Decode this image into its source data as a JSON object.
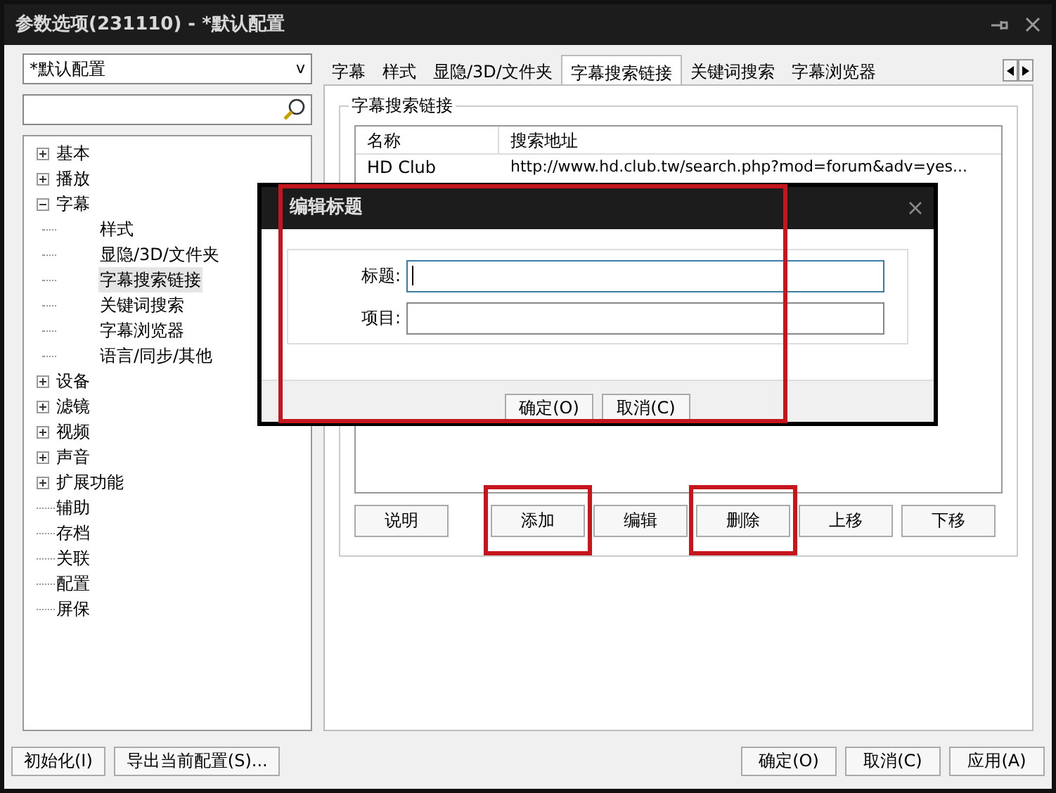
{
  "window": {
    "title": "参数选项(231110) - *默认配置"
  },
  "profile_dropdown": {
    "value": "*默认配置",
    "caret": "v"
  },
  "tree": [
    {
      "label": "基本",
      "expanded": false,
      "selected": false
    },
    {
      "label": "播放",
      "expanded": false,
      "selected": false
    },
    {
      "label": "字幕",
      "expanded": true,
      "selected": false,
      "children": [
        {
          "label": "样式",
          "selected": false
        },
        {
          "label": "显隐/3D/文件夹",
          "selected": false
        },
        {
          "label": "字幕搜索链接",
          "selected": true
        },
        {
          "label": "关键词搜索",
          "selected": false
        },
        {
          "label": "字幕浏览器",
          "selected": false
        },
        {
          "label": "语言/同步/其他",
          "selected": false
        }
      ]
    },
    {
      "label": "设备",
      "expanded": false,
      "selected": false
    },
    {
      "label": "滤镜",
      "expanded": false,
      "selected": false
    },
    {
      "label": "视频",
      "expanded": false,
      "selected": false
    },
    {
      "label": "声音",
      "expanded": false,
      "selected": false
    },
    {
      "label": "扩展功能",
      "expanded": false,
      "selected": false
    },
    {
      "label": "辅助",
      "selected": false
    },
    {
      "label": "存档",
      "selected": false
    },
    {
      "label": "关联",
      "selected": false
    },
    {
      "label": "配置",
      "selected": false
    },
    {
      "label": "屏保",
      "selected": false
    }
  ],
  "tabs": [
    {
      "label": "字幕",
      "selected": false
    },
    {
      "label": "样式",
      "selected": false
    },
    {
      "label": "显隐/3D/文件夹",
      "selected": false
    },
    {
      "label": "字幕搜索链接",
      "selected": true
    },
    {
      "label": "关键词搜索",
      "selected": false
    },
    {
      "label": "字幕浏览器",
      "selected": false
    }
  ],
  "group": {
    "title": "字幕搜索链接",
    "table": {
      "columns": [
        "名称",
        "搜索地址"
      ],
      "rows": [
        [
          "HD Club",
          "http://www.hd.club.tw/search.php?mod=forum&adv=yes..."
        ]
      ]
    },
    "buttons": [
      {
        "label": "说明",
        "highlighted": false
      },
      {
        "label": "添加",
        "highlighted": true
      },
      {
        "label": "编辑",
        "highlighted": false
      },
      {
        "label": "删除",
        "highlighted": true
      },
      {
        "label": "上移",
        "highlighted": false
      },
      {
        "label": "下移",
        "highlighted": false
      }
    ]
  },
  "dialog": {
    "title": "编辑标题",
    "highlighted": true,
    "fields": [
      {
        "label": "标题:",
        "focused": true
      },
      {
        "label": "项目:",
        "focused": false
      }
    ],
    "buttons": [
      "确定(O)",
      "取消(C)"
    ]
  },
  "footer_left": [
    "初始化(I)",
    "导出当前配置(S)..."
  ],
  "footer_right": [
    "确定(O)",
    "取消(C)",
    "应用(A)"
  ]
}
